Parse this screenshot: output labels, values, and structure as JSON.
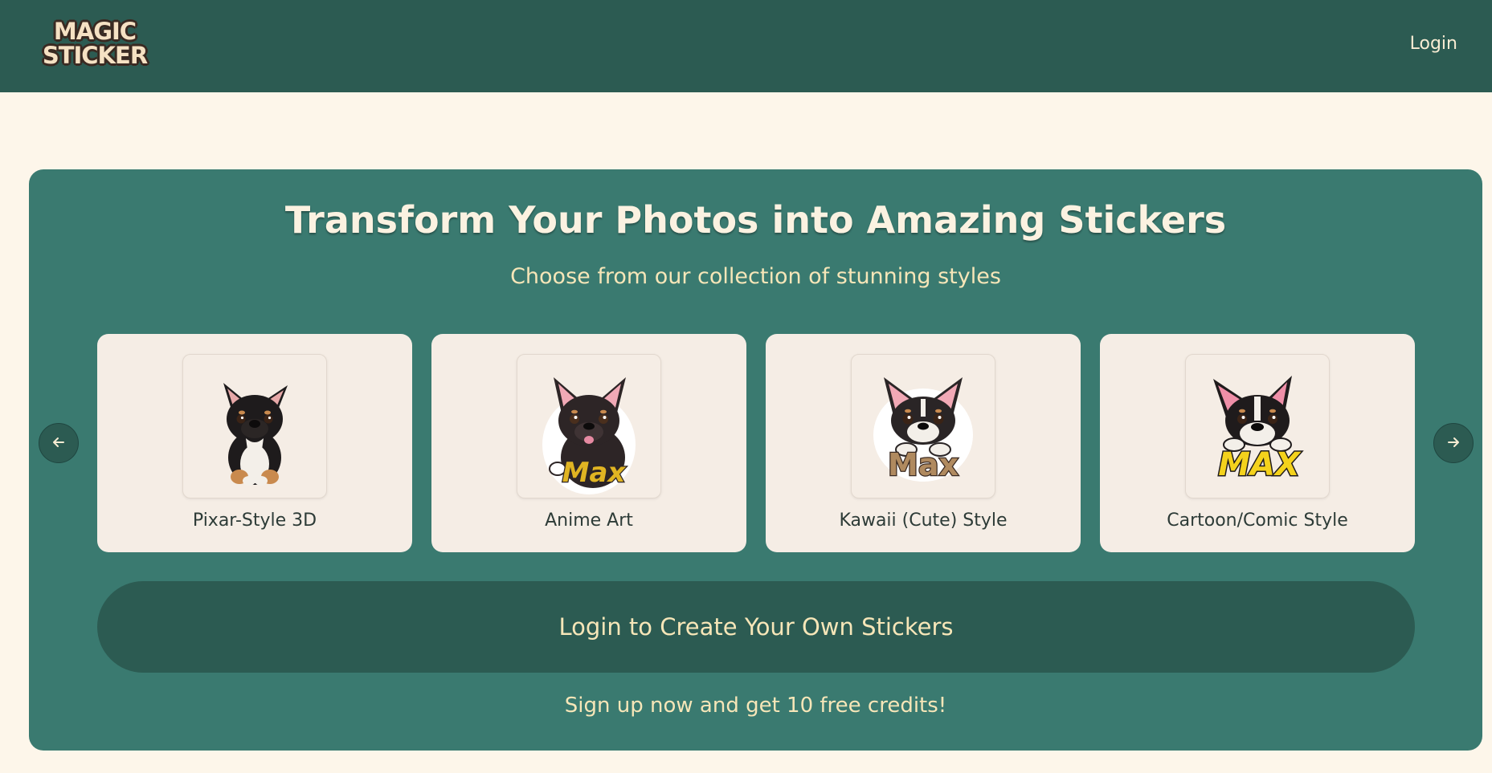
{
  "header": {
    "logo_line1": "MAGIC",
    "logo_line2": "STICKER",
    "login_label": "Login"
  },
  "hero": {
    "title": "Transform Your Photos into Amazing Stickers",
    "subtitle": "Choose from our collection of stunning styles",
    "prev_icon": "arrow-left-icon",
    "next_icon": "arrow-right-icon",
    "styles": [
      {
        "label": "Pixar-Style 3D",
        "sticker_text": ""
      },
      {
        "label": "Anime Art",
        "sticker_text": "Max"
      },
      {
        "label": "Kawaii (Cute) Style",
        "sticker_text": "Max"
      },
      {
        "label": "Cartoon/Comic Style",
        "sticker_text": "MAX"
      }
    ],
    "cta_label": "Login to Create Your Own Stickers",
    "promo_text": "Sign up now and get 10 free credits!"
  },
  "colors": {
    "header_bg": "#2c5b52",
    "page_bg": "#fdf6ea",
    "hero_bg": "#3a7a70",
    "card_bg": "#f5ede5",
    "accent_text": "#f6e6b8"
  }
}
